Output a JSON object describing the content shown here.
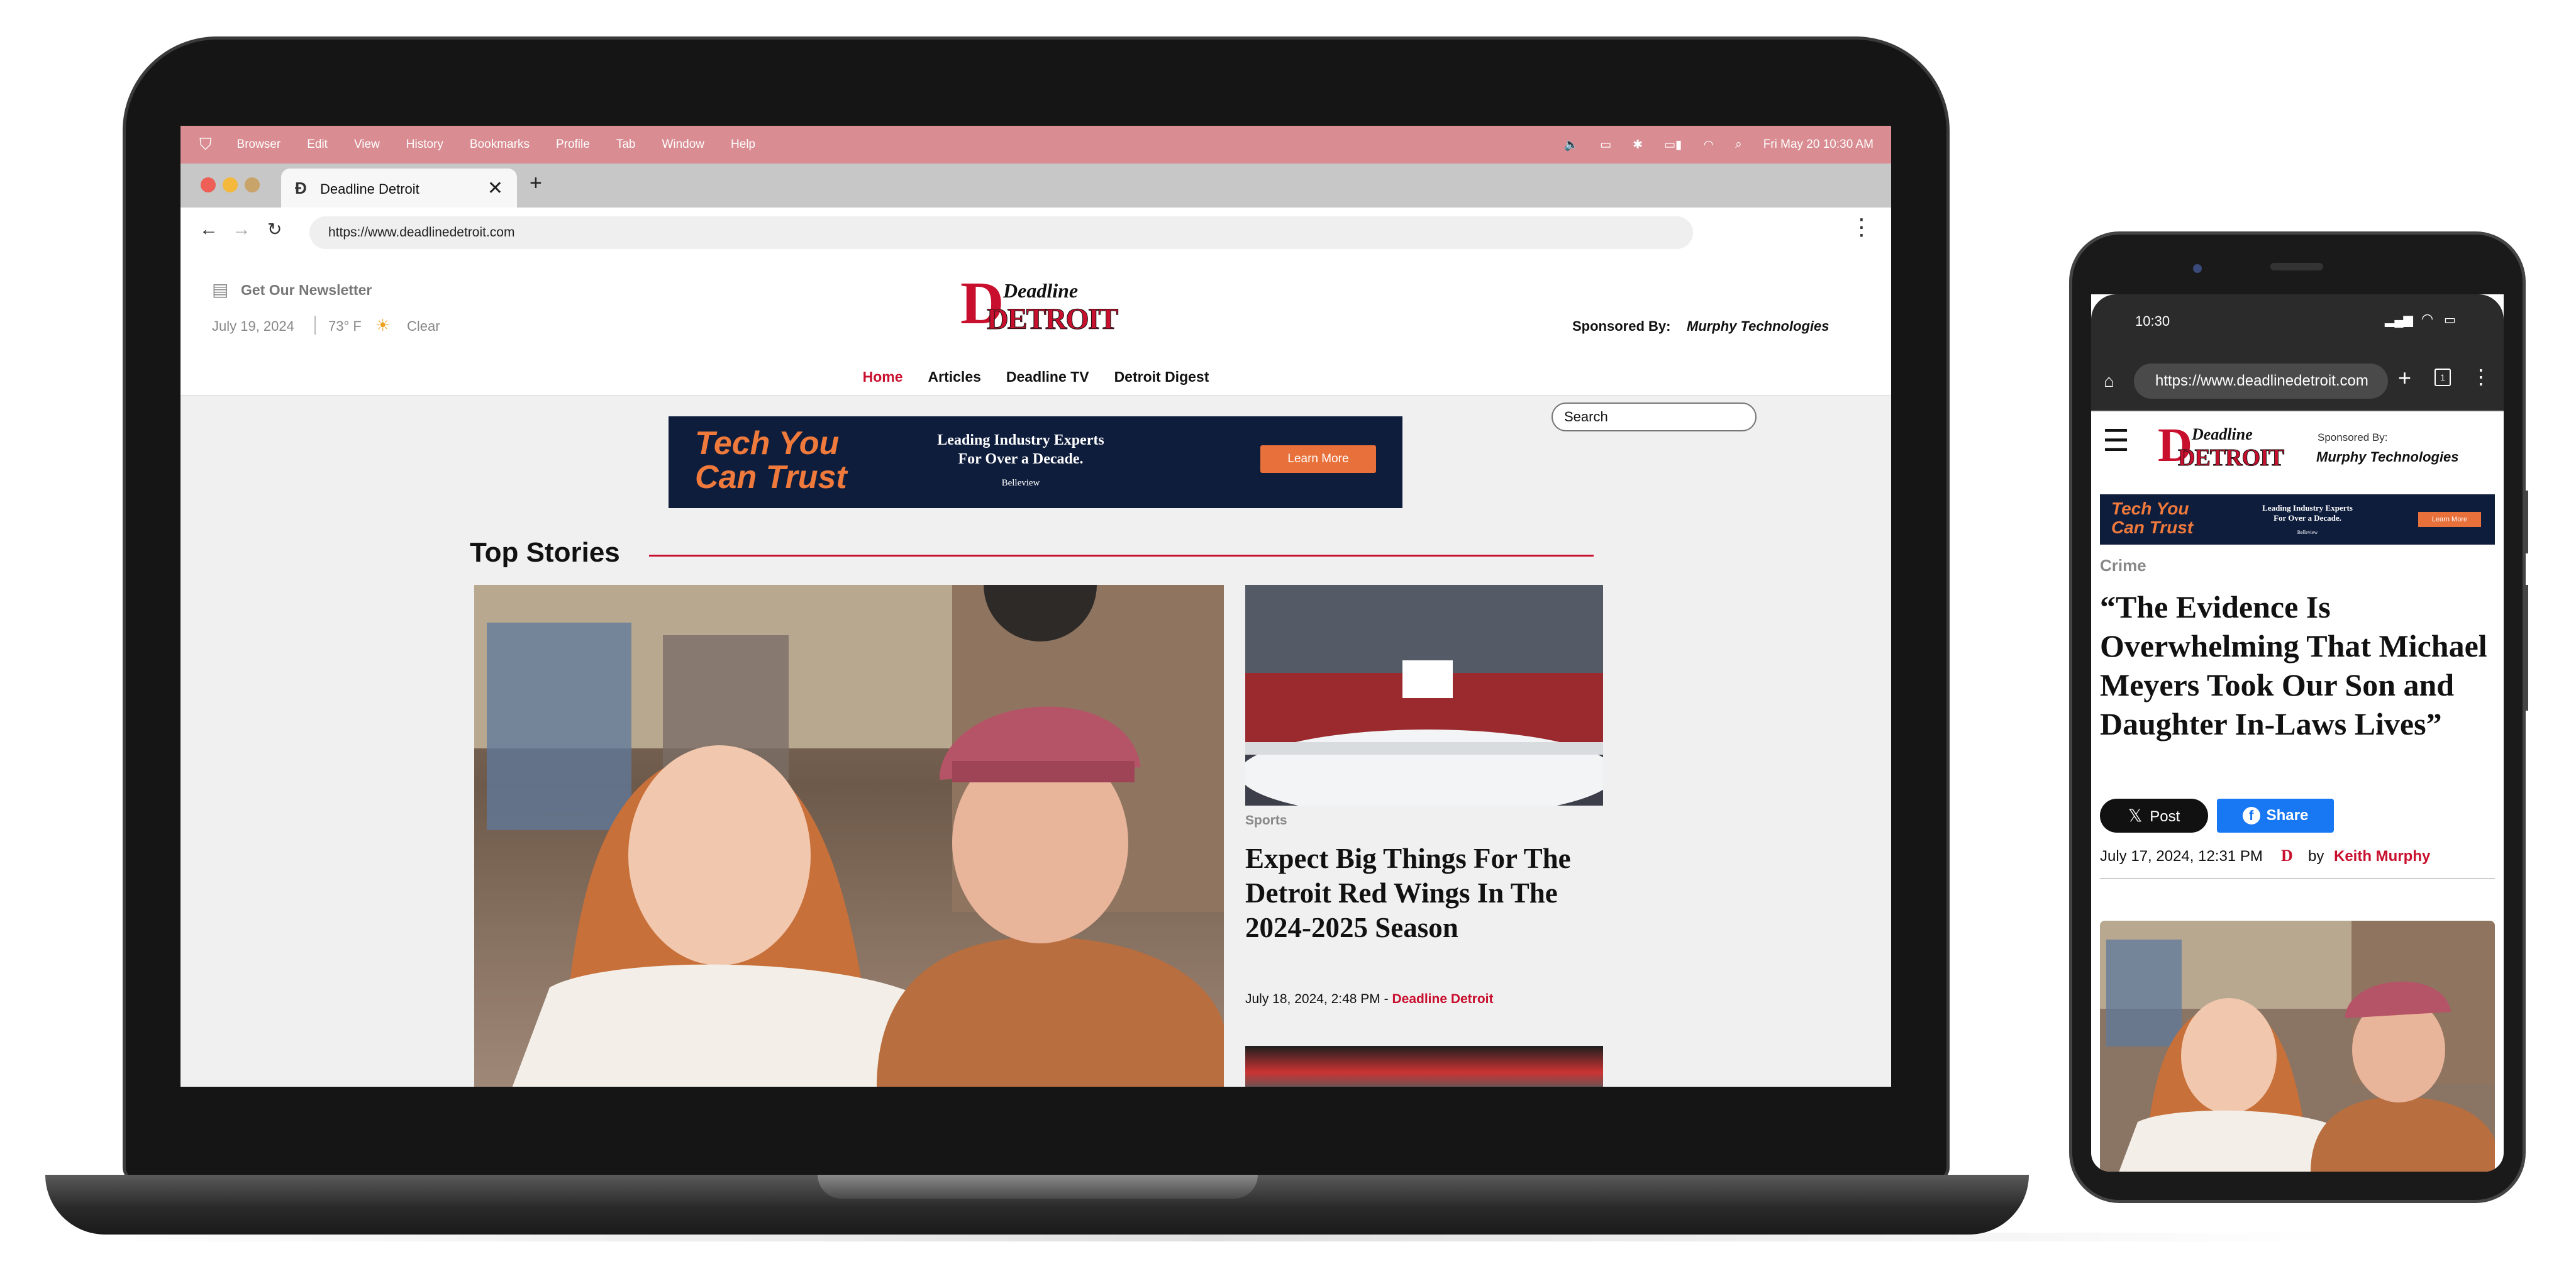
{
  "menubar": {
    "items": [
      "Browser",
      "Edit",
      "View",
      "History",
      "Bookmarks",
      "Profile",
      "Tab",
      "Window",
      "Help"
    ],
    "datetime": "Fri May 20  10:30 AM"
  },
  "browser": {
    "tab_title": "Deadline Detroit",
    "new_tab": "+",
    "close": "✕",
    "url": "https://www.deadlinedetroit.com"
  },
  "site": {
    "newsletter": "Get Our Newsletter",
    "date": "July 19, 2024",
    "temp": "73° F",
    "weather": "Clear",
    "logo_top": "Deadline",
    "logo_bottom": "DETROIT",
    "search_placeholder": "Search",
    "sponsor_label": "Sponsored By:",
    "sponsor_name": "Murphy Technologies",
    "nav": [
      "Home",
      "Articles",
      "Deadline TV",
      "Detroit Digest"
    ],
    "accent": "#c8102e"
  },
  "ad": {
    "headline_1": "Tech You",
    "headline_2": "Can Trust",
    "tagline_1": "Leading Industry Experts",
    "tagline_2": "For Over a Decade.",
    "brand": "Belleview",
    "cta": "Learn More"
  },
  "top_stories": {
    "title": "Top Stories",
    "side": {
      "category": "Sports",
      "headline": "Expect Big Things For The Detroit Red Wings In The 2024-2025 Season",
      "meta": "July 18, 2024, 2:48 PM - ",
      "source": "Deadline Detroit"
    }
  },
  "phone": {
    "time": "10:30",
    "url": "https://www.deadlinedetroit.com",
    "sponsor_label": "Sponsored By:",
    "sponsor_name": "Murphy Technologies",
    "category": "Crime",
    "headline": "“The Evidence Is Overwhelming That Michael Meyers Took Our Son and Daughter In-Laws Lives”",
    "post_btn": "Post",
    "share_btn": "Share",
    "date": "July 17, 2024, 12:31 PM",
    "by": "by",
    "author": "Keith Murphy"
  }
}
